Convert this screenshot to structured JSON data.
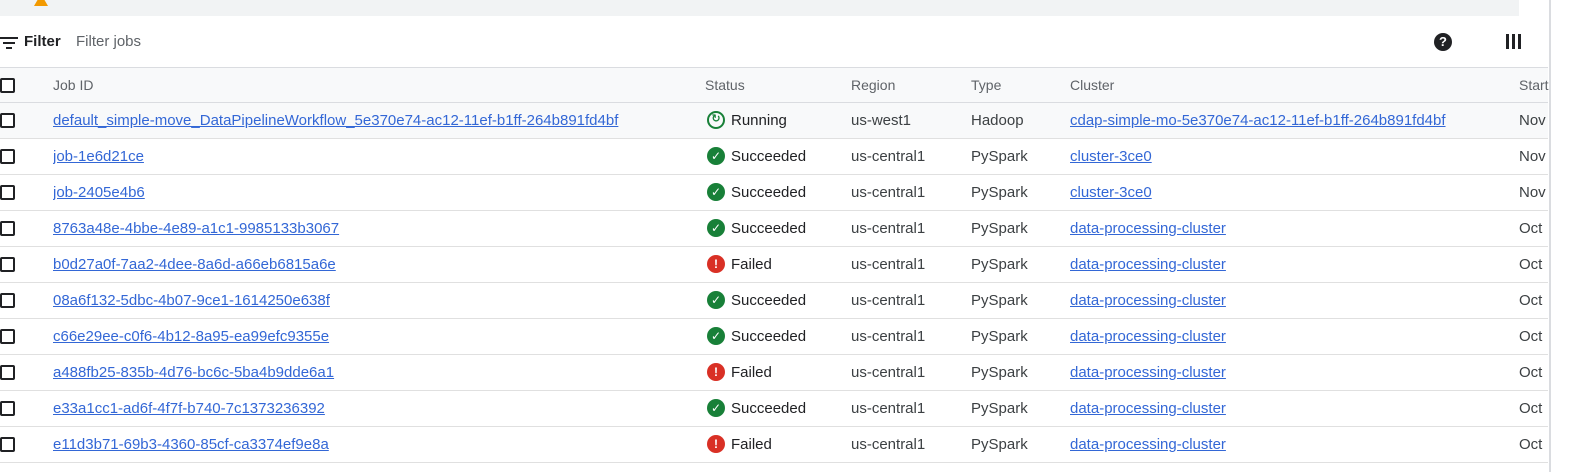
{
  "banner": {
    "text_before": "",
    "link_text": "",
    "text_after": ""
  },
  "filter": {
    "label": "Filter",
    "placeholder": "Filter jobs",
    "icon": "filter-list-icon",
    "help_icon": "help-icon",
    "columns_icon": "column-display-icon"
  },
  "table": {
    "headers": {
      "job_id": "Job ID",
      "status": "Status",
      "region": "Region",
      "type": "Type",
      "cluster": "Cluster",
      "start": "Start"
    },
    "rows": [
      {
        "job_id": "default_simple-move_DataPipelineWorkflow_5e370e74-ac12-11ef-b1ff-264b891fd4bf",
        "status": "Running",
        "status_icon": "running-icon",
        "region": "us-west1",
        "type": "Hadoop",
        "cluster": "cdap-simple-mo-5e370e74-ac12-11ef-b1ff-264b891fd4bf",
        "start": "Nov"
      },
      {
        "job_id": "job-1e6d21ce",
        "status": "Succeeded",
        "status_icon": "check-circle-icon",
        "region": "us-central1",
        "type": "PySpark",
        "cluster": "cluster-3ce0",
        "start": "Nov"
      },
      {
        "job_id": "job-2405e4b6",
        "status": "Succeeded",
        "status_icon": "check-circle-icon",
        "region": "us-central1",
        "type": "PySpark",
        "cluster": "cluster-3ce0",
        "start": "Nov"
      },
      {
        "job_id": "8763a48e-4bbe-4e89-a1c1-9985133b3067",
        "status": "Succeeded",
        "status_icon": "check-circle-icon",
        "region": "us-central1",
        "type": "PySpark",
        "cluster": "data-processing-cluster",
        "start": "Oct"
      },
      {
        "job_id": "b0d27a0f-7aa2-4dee-8a6d-a66eb6815a6e",
        "status": "Failed",
        "status_icon": "error-icon",
        "region": "us-central1",
        "type": "PySpark",
        "cluster": "data-processing-cluster",
        "start": "Oct"
      },
      {
        "job_id": "08a6f132-5dbc-4b07-9ce1-1614250e638f",
        "status": "Succeeded",
        "status_icon": "check-circle-icon",
        "region": "us-central1",
        "type": "PySpark",
        "cluster": "data-processing-cluster",
        "start": "Oct"
      },
      {
        "job_id": "c66e29ee-c0f6-4b12-8a95-ea99efc9355e",
        "status": "Succeeded",
        "status_icon": "check-circle-icon",
        "region": "us-central1",
        "type": "PySpark",
        "cluster": "data-processing-cluster",
        "start": "Oct"
      },
      {
        "job_id": "a488fb25-835b-4d76-bc6c-5ba4b9dde6a1",
        "status": "Failed",
        "status_icon": "error-icon",
        "region": "us-central1",
        "type": "PySpark",
        "cluster": "data-processing-cluster",
        "start": "Oct"
      },
      {
        "job_id": "e33a1cc1-ad6f-4f7f-b740-7c1373236392",
        "status": "Succeeded",
        "status_icon": "check-circle-icon",
        "region": "us-central1",
        "type": "PySpark",
        "cluster": "data-processing-cluster",
        "start": "Oct"
      },
      {
        "job_id": "e11d3b71-69b3-4360-85cf-ca3374ef9e8a",
        "status": "Failed",
        "status_icon": "error-icon",
        "region": "us-central1",
        "type": "PySpark",
        "cluster": "data-processing-cluster",
        "start": "Oct"
      }
    ]
  },
  "colors": {
    "link": "#3367d6",
    "success": "#188038",
    "error": "#d93025",
    "warning": "#f29900",
    "header_bg": "#f8f9fa"
  }
}
